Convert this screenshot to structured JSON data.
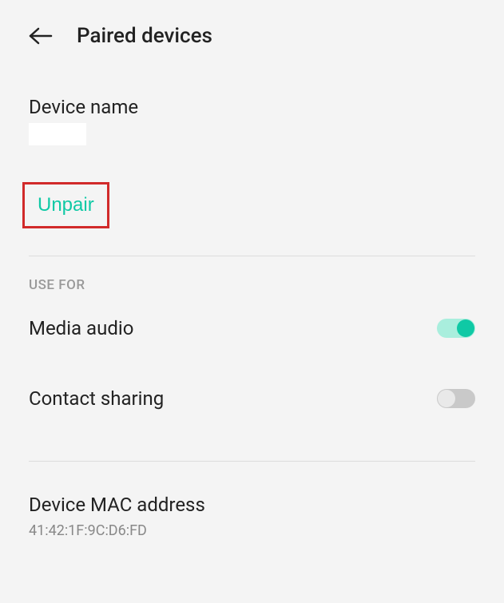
{
  "header": {
    "title": "Paired devices"
  },
  "device_name": {
    "label": "Device name",
    "value": ""
  },
  "unpair": {
    "label": "Unpair"
  },
  "use_for": {
    "header": "USE FOR",
    "media_audio": {
      "label": "Media audio",
      "enabled": true
    },
    "contact_sharing": {
      "label": "Contact sharing",
      "enabled": false
    }
  },
  "mac": {
    "label": "Device MAC address",
    "value": "41:42:1F:9C:D6:FD"
  },
  "colors": {
    "accent": "#0fc9a5",
    "highlight_border": "#d12a2a"
  }
}
